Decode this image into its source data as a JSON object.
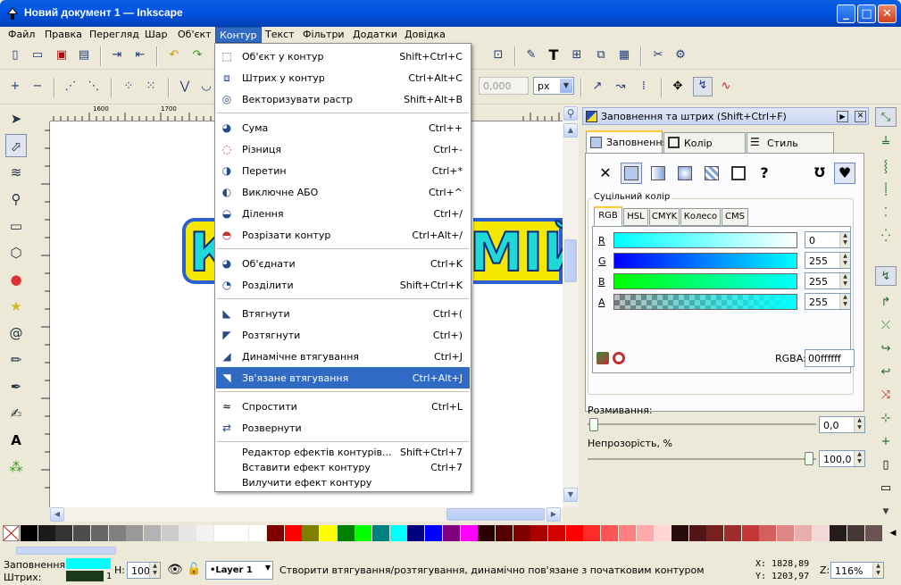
{
  "window": {
    "title": "Новий документ 1 — Inkscape",
    "minimize": "_",
    "maximize": "□",
    "close": "✕"
  },
  "menubar": [
    "Файл",
    "Правка",
    "Перегляд",
    "Шар",
    "Об'єкт",
    "Контур",
    "Текст",
    "Фільтри",
    "Додатки",
    "Довідка"
  ],
  "active_menu": "Контур",
  "toolbar2": {
    "value": "0,000",
    "unit": "px"
  },
  "ruler": {
    "ticks": [
      "1600",
      "1700"
    ]
  },
  "canvas_text": "К",
  "canvas_text_right": "МІЙ",
  "path_menu": {
    "items": [
      {
        "icon": "object-to-path-icon",
        "label": "Об'єкт у контур",
        "shortcut": "Shift+Ctrl+C"
      },
      {
        "icon": "stroke-to-path-icon",
        "label": "Штрих у контур",
        "shortcut": "Ctrl+Alt+C"
      },
      {
        "icon": "trace-bitmap-icon",
        "label": "Векторизувати растр",
        "shortcut": "Shift+Alt+B"
      },
      {
        "sep": true
      },
      {
        "icon": "union-icon",
        "label": "Сума",
        "shortcut": "Ctrl++"
      },
      {
        "icon": "difference-icon",
        "label": "Різниця",
        "shortcut": "Ctrl+-"
      },
      {
        "icon": "intersection-icon",
        "label": "Перетин",
        "shortcut": "Ctrl+*"
      },
      {
        "icon": "exclusion-icon",
        "label": "Виключне АБО",
        "shortcut": "Ctrl+^"
      },
      {
        "icon": "division-icon",
        "label": "Ділення",
        "shortcut": "Ctrl+/"
      },
      {
        "icon": "cut-path-icon",
        "label": "Розрізати контур",
        "shortcut": "Ctrl+Alt+/"
      },
      {
        "sep": true
      },
      {
        "icon": "combine-icon",
        "label": "Об'єднати",
        "shortcut": "Ctrl+K"
      },
      {
        "icon": "break-apart-icon",
        "label": "Розділити",
        "shortcut": "Shift+Ctrl+K"
      },
      {
        "sep": true
      },
      {
        "icon": "inset-icon",
        "label": "Втягнути",
        "shortcut": "Ctrl+("
      },
      {
        "icon": "outset-icon",
        "label": "Розтягнути",
        "shortcut": "Ctrl+)"
      },
      {
        "icon": "dynamic-offset-icon",
        "label": "Динамічне втягування",
        "shortcut": "Ctrl+J"
      },
      {
        "icon": "linked-offset-icon",
        "label": "Зв'язане втягування",
        "shortcut": "Ctrl+Alt+J",
        "highlighted": true
      },
      {
        "sep": true
      },
      {
        "icon": "simplify-icon",
        "label": "Спростити",
        "shortcut": "Ctrl+L"
      },
      {
        "icon": "reverse-icon",
        "label": "Розвернути",
        "shortcut": ""
      },
      {
        "sep": true
      },
      {
        "icon": "",
        "label": "Редактор ефектів контурів...",
        "shortcut": "Shift+Ctrl+7"
      },
      {
        "icon": "",
        "label": "Вставити ефект контуру",
        "shortcut": "Ctrl+7"
      },
      {
        "icon": "",
        "label": "Вилучити ефект контуру",
        "shortcut": ""
      }
    ]
  },
  "dialog": {
    "title": "Заповнення та штрих (Shift+Ctrl+F)",
    "tabs": [
      "Заповнення",
      "Колір штриха",
      "Стиль штриха"
    ],
    "mode_label": "Суцільний колір",
    "subtabs": [
      "RGB",
      "HSL",
      "CMYK",
      "Колесо",
      "CMS"
    ],
    "channels": [
      {
        "name": "R",
        "value": "0"
      },
      {
        "name": "G",
        "value": "255"
      },
      {
        "name": "B",
        "value": "255"
      },
      {
        "name": "A",
        "value": "255"
      }
    ],
    "rgba_label": "RGBA:",
    "rgba_value": "00ffffff",
    "blur_label": "Розмивання:",
    "blur_value": "0,0",
    "opacity_label": "Непрозорість, %",
    "opacity_value": "100,0",
    "unknown_glyph": "?"
  },
  "statusbar": {
    "fill_label": "Заповнення:",
    "stroke_label": "Штрих:",
    "fill_color": "#00ffff",
    "stroke_color": "#1a3a1a",
    "stroke_width": "1",
    "h_label": "H:",
    "h_value": "100",
    "layer": "•Layer 1",
    "message": "Створити втягування/розтягування, динамічно пов'язане з початковим контуром",
    "x_coord": "X: 1828,89",
    "y_coord": "Y: 1203,97",
    "zoom_label": "Z:",
    "zoom_value": "116%"
  },
  "palette": [
    "#000000",
    "#1a1a1a",
    "#333333",
    "#4d4d4d",
    "#666666",
    "#808080",
    "#999999",
    "#b3b3b3",
    "#cccccc",
    "#e6e6e6",
    "#f2f2f2",
    "#ffffff",
    "#ffffff",
    "#ffffff",
    "#800000",
    "#ff0000",
    "#808000",
    "#ffff00",
    "#008000",
    "#00ff00",
    "#008080",
    "#00ffff",
    "#000080",
    "#0000ff",
    "#800080",
    "#ff00ff",
    "#2b0000",
    "#550000",
    "#800000",
    "#aa0000",
    "#d40000",
    "#ff0000",
    "#ff2a2a",
    "#ff5555",
    "#ff8080",
    "#ffaaaa",
    "#ffd5d5",
    "#280b0b",
    "#501616",
    "#782121",
    "#a02c2c",
    "#c83737",
    "#d35f5f",
    "#de8787",
    "#e9afaf",
    "#f4d7d7",
    "#241c1c",
    "#483737",
    "#6c5353"
  ]
}
